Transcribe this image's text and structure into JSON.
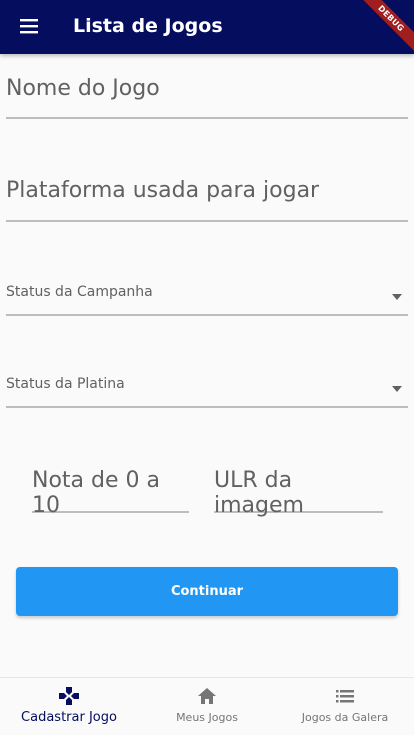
{
  "app_bar": {
    "title": "Lista de Jogos",
    "debug_label": "DEBUG",
    "menu_icon": "menu-icon",
    "background": "#040d5e"
  },
  "form": {
    "game_name_placeholder": "Nome do Jogo",
    "platform_placeholder": "Plataforma usada para jogar",
    "campaign_status_label": "Status da Campanha",
    "platinum_status_label": "Status da Platina",
    "score_placeholder": "Nota de 0 a 10",
    "image_url_placeholder": "ULR da imagem",
    "continue_label": "Continuar",
    "accent": "#2196f3"
  },
  "bottom_nav": {
    "items": [
      {
        "label": "Cadastrar Jogo",
        "icon": "gamepad-icon",
        "active": true
      },
      {
        "label": "Meus Jogos",
        "icon": "home-icon",
        "active": false
      },
      {
        "label": "Jogos da Galera",
        "icon": "list-icon",
        "active": false
      }
    ]
  }
}
